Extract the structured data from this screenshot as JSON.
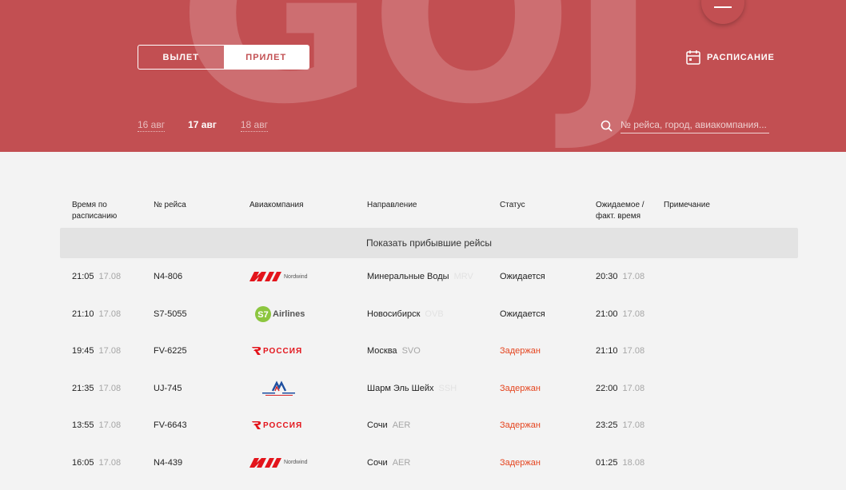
{
  "hero": {
    "bg_text": "GOJ",
    "tabs": [
      {
        "label": "ВЫЛЕТ",
        "active": false
      },
      {
        "label": "ПРИЛЕТ",
        "active": true
      }
    ],
    "schedule_label": "РАСПИСАНИЕ",
    "dates": [
      {
        "label": "16 авг",
        "current": false
      },
      {
        "label": "17 авг",
        "current": true
      },
      {
        "label": "18 авг",
        "current": false
      }
    ],
    "search_placeholder": "№ рейса, город, авиакомпания..."
  },
  "table": {
    "headers": {
      "time": "Время по расписанию",
      "flight": "№ рейса",
      "airline": "Авиакомпания",
      "direction": "Направление",
      "status": "Статус",
      "expected": "Ожидаемое / факт. время",
      "note": "Примечание"
    },
    "show_arrived_label": "Показать прибывшие рейсы",
    "rows": [
      {
        "time": "21:05",
        "date": "17.08",
        "flight": "N4-806",
        "airline_logo": "nordwind",
        "city": "Минеральные Воды",
        "code": "MRV",
        "status": "Ожидается",
        "status_type": "normal",
        "exp_time": "20:30",
        "exp_date": "17.08"
      },
      {
        "time": "21:10",
        "date": "17.08",
        "flight": "S7-5055",
        "airline_logo": "s7",
        "city": "Новосибирск",
        "code": "OVB",
        "status": "Ожидается",
        "status_type": "normal",
        "exp_time": "21:00",
        "exp_date": "17.08"
      },
      {
        "time": "19:45",
        "date": "17.08",
        "flight": "FV-6225",
        "airline_logo": "rossiya",
        "city": "Москва",
        "code": "SVO",
        "status": "Задержан",
        "status_type": "delayed",
        "exp_time": "21:10",
        "exp_date": "17.08"
      },
      {
        "time": "21:35",
        "date": "17.08",
        "flight": "UJ-745",
        "airline_logo": "almasria",
        "city": "Шарм Эль Шейх",
        "code": "SSH",
        "status": "Задержан",
        "status_type": "delayed",
        "exp_time": "22:00",
        "exp_date": "17.08"
      },
      {
        "time": "13:55",
        "date": "17.08",
        "flight": "FV-6643",
        "airline_logo": "rossiya",
        "city": "Сочи",
        "code": "AER",
        "status": "Задержан",
        "status_type": "delayed",
        "exp_time": "23:25",
        "exp_date": "17.08"
      },
      {
        "time": "16:05",
        "date": "17.08",
        "flight": "N4-439",
        "airline_logo": "nordwind",
        "city": "Сочи",
        "code": "AER",
        "status": "Задержан",
        "status_type": "delayed",
        "exp_time": "01:25",
        "exp_date": "18.08"
      }
    ]
  },
  "logos": {
    "nordwind_text": "Nordwind",
    "s7_text": "Airlines",
    "rossiya_text": "РОССИЯ"
  },
  "colors": {
    "brand": "#c24f52",
    "delayed": "#e5451f",
    "muted": "#a6a6a6"
  }
}
